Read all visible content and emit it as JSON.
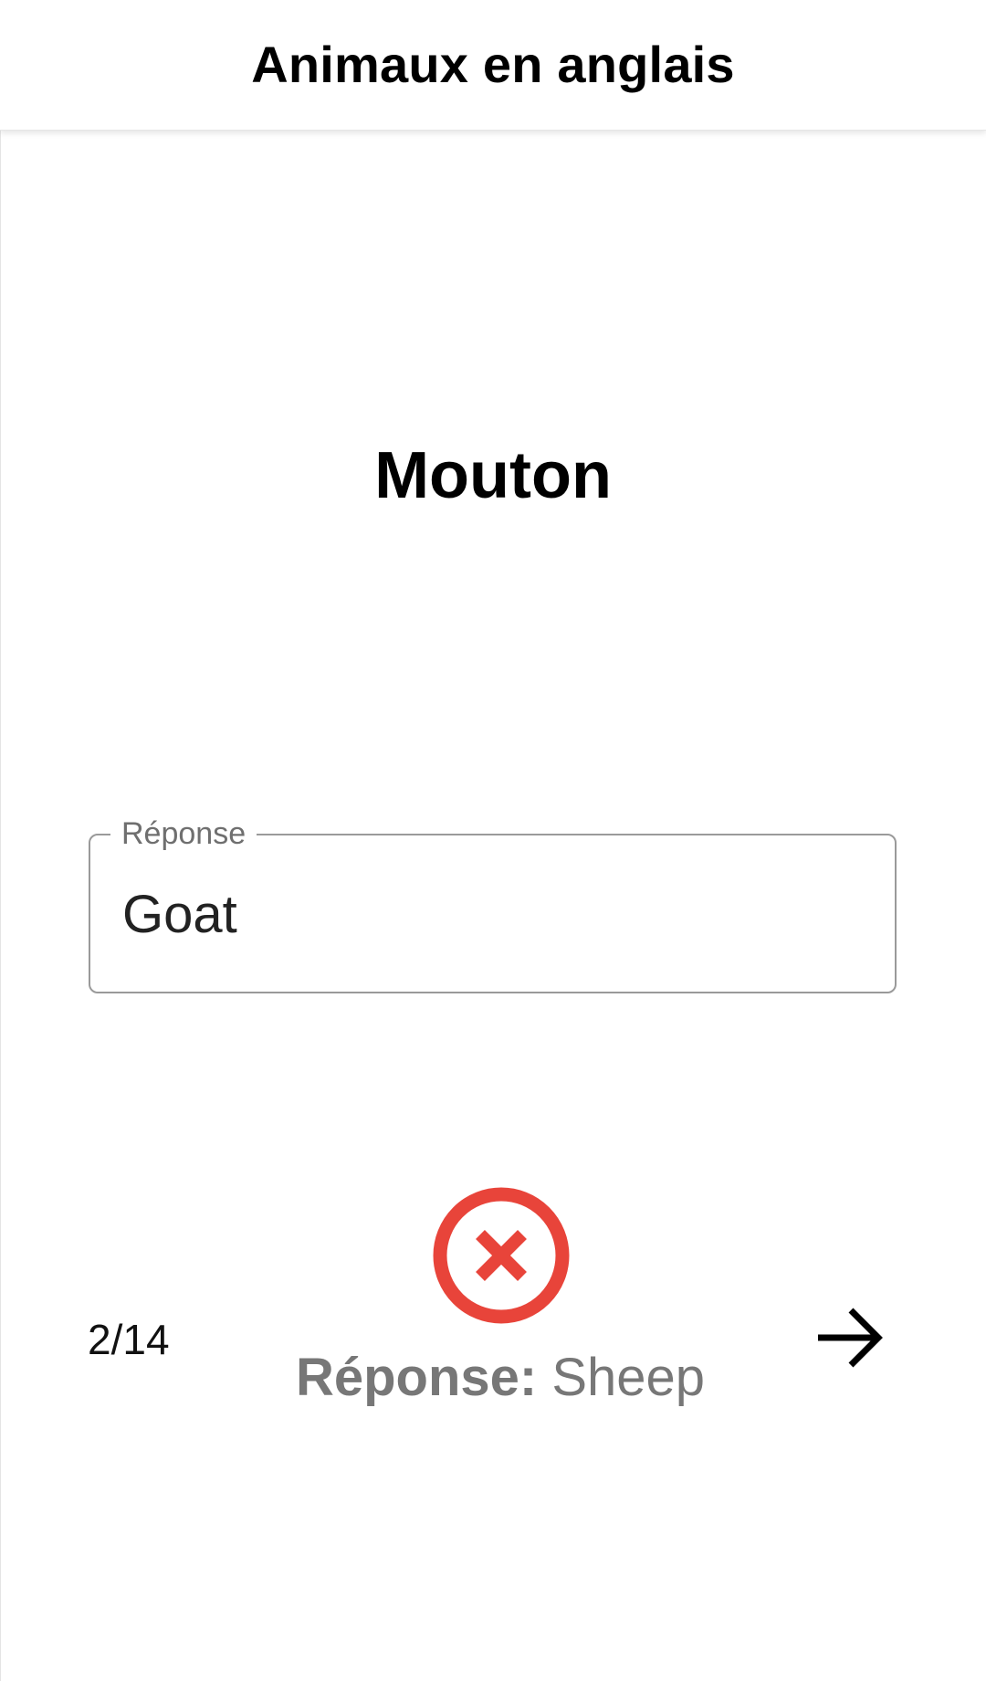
{
  "header": {
    "title": "Animaux en anglais"
  },
  "quiz": {
    "question": "Mouton",
    "answer_field": {
      "label": "Réponse",
      "value": "Goat"
    },
    "result": {
      "status": "incorrect",
      "icon": "close-circle-icon",
      "color": "#e8443a"
    },
    "correction": {
      "label": "Réponse:",
      "value": "Sheep"
    },
    "progress": {
      "text": "2/14",
      "current": 2,
      "total": 14
    },
    "next_icon": "arrow-right-icon"
  }
}
